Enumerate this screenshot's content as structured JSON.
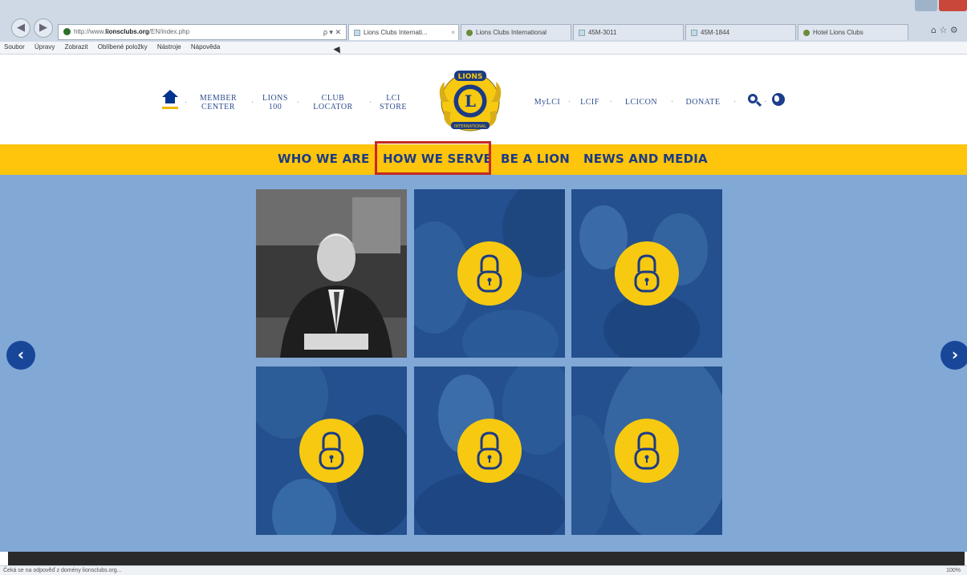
{
  "browser": {
    "address_prefix": "http://www.",
    "address_domain": "lionsclubs.org",
    "address_path": "/EN/index.php",
    "address_controls": "ρ ▾ ✕",
    "tabs": [
      {
        "label": "Lions Clubs Internati...",
        "active": true,
        "icon": "page-icon"
      },
      {
        "label": "Lions Clubs International",
        "active": false,
        "icon": "globe-icon"
      },
      {
        "label": "45M-3011",
        "active": false,
        "icon": "doc-icon"
      },
      {
        "label": "45M-1844",
        "active": false,
        "icon": "doc-icon"
      },
      {
        "label": "Hotel Lions Clubs",
        "active": false,
        "icon": "globe-icon"
      }
    ],
    "menu": [
      "Soubor",
      "Úpravy",
      "Zobrazit",
      "Oblíbené položky",
      "Nástroje",
      "Nápověda"
    ]
  },
  "header": {
    "links_left": [
      {
        "label": "MEMBER CENTER"
      },
      {
        "label": "LIONS 100"
      },
      {
        "label": "CLUB LOCATOR"
      },
      {
        "label": "LCI STORE"
      }
    ],
    "links_right": [
      "MyLCI",
      "LCIF",
      "LCICON",
      "DONATE"
    ],
    "separator": "·",
    "logo_text_top": "LIONS",
    "logo_letter": "L",
    "logo_text_bottom": "INTERNATIONAL"
  },
  "nav": {
    "items": [
      "WHO WE ARE",
      "HOW WE SERVE",
      "BE A LION",
      "NEWS AND MEDIA"
    ],
    "highlighted": "HOW WE SERVE"
  },
  "carousel": {
    "prev_label": "‹",
    "next_label": "›",
    "tiles": [
      {
        "kind": "photo",
        "locked": false
      },
      {
        "kind": "image",
        "locked": true
      },
      {
        "kind": "image",
        "locked": true
      },
      {
        "kind": "image",
        "locked": true
      },
      {
        "kind": "image",
        "locked": true
      },
      {
        "kind": "image",
        "locked": true
      }
    ]
  },
  "status": {
    "text": "Čeká se na odpověď z domény lionsclubs.org...",
    "zoom": "100%"
  },
  "colors": {
    "brand_yellow": "#ffc40c",
    "brand_blue": "#1b3b84",
    "content_bg": "#82a8d6",
    "highlight_red": "#c42a1f"
  }
}
